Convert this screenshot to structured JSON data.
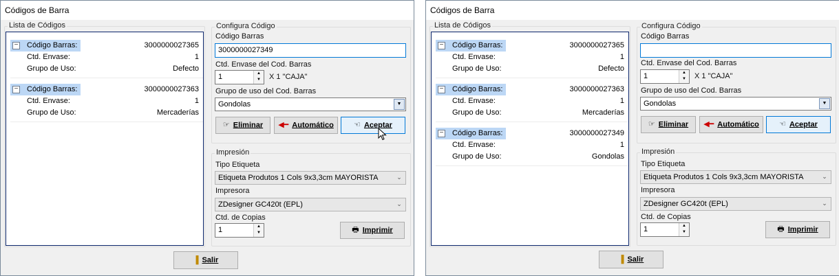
{
  "windows": [
    {
      "title": "Códigos de Barra",
      "codes_group_title": "Lista de Códigos",
      "codes": [
        {
          "barcode_label": "Código Barras:",
          "barcode": "3000000027365",
          "qty_label": "Ctd. Envase:",
          "qty": "1",
          "group_label": "Grupo de Uso:",
          "group": "Defecto"
        },
        {
          "barcode_label": "Código Barras:",
          "barcode": "3000000027363",
          "qty_label": "Ctd. Envase:",
          "qty": "1",
          "group_label": "Grupo de Uso:",
          "group": "Mercaderías"
        }
      ],
      "config": {
        "group_title": "Configura Código",
        "barcode_label": "Código Barras",
        "barcode_value": "3000000027349",
        "qty_label": "Ctd. Envase del Cod. Barras",
        "qty_value": "1",
        "qty_suffix": "X 1 \"CAJA\"",
        "use_group_label": "Grupo de uso del Cod. Barras",
        "use_group_value": "Gondolas",
        "delete_label": "Eliminar",
        "auto_label": "Automático",
        "accept_label": "Aceptar"
      },
      "print": {
        "group_title": "Impresión",
        "label_type_label": "Tipo Etiqueta",
        "label_type_value": "Etiqueta Produtos 1 Cols 9x3,3cm MAYORISTA",
        "printer_label": "Impresora",
        "printer_value": "ZDesigner GC420t (EPL)",
        "copies_label": "Ctd. de Copias",
        "copies_value": "1",
        "print_label": "Imprimir"
      },
      "exit_label": "Salir"
    },
    {
      "title": "Códigos de Barra",
      "codes_group_title": "Lista de Códigos",
      "codes": [
        {
          "barcode_label": "Código Barras:",
          "barcode": "3000000027365",
          "qty_label": "Ctd. Envase:",
          "qty": "1",
          "group_label": "Grupo de Uso:",
          "group": "Defecto"
        },
        {
          "barcode_label": "Código Barras:",
          "barcode": "3000000027363",
          "qty_label": "Ctd. Envase:",
          "qty": "1",
          "group_label": "Grupo de Uso:",
          "group": "Mercaderías"
        },
        {
          "barcode_label": "Código Barras:",
          "barcode": "3000000027349",
          "qty_label": "Ctd. Envase:",
          "qty": "1",
          "group_label": "Grupo de Uso:",
          "group": "Gondolas"
        }
      ],
      "config": {
        "group_title": "Configura Código",
        "barcode_label": "Código Barras",
        "barcode_value": "",
        "qty_label": "Ctd. Envase del Cod. Barras",
        "qty_value": "1",
        "qty_suffix": "X 1 \"CAJA\"",
        "use_group_label": "Grupo de uso del Cod. Barras",
        "use_group_value": "Gondolas",
        "delete_label": "Eliminar",
        "auto_label": "Automático",
        "accept_label": "Aceptar"
      },
      "print": {
        "group_title": "Impresión",
        "label_type_label": "Tipo Etiqueta",
        "label_type_value": "Etiqueta Produtos 1 Cols 9x3,3cm MAYORISTA",
        "printer_label": "Impresora",
        "printer_value": "ZDesigner GC420t (EPL)",
        "copies_label": "Ctd. de Copias",
        "copies_value": "1",
        "print_label": "Imprimir"
      },
      "exit_label": "Salir"
    }
  ],
  "icons": {
    "delete": "pointing-hand-icon",
    "auto": "red-arrow-left-icon",
    "accept": "pointing-hand-icon",
    "print": "printer-icon",
    "exit": "exit-door-icon",
    "collapse": "minus-box-icon",
    "cursor": "mouse-pointer-icon"
  },
  "colors": {
    "accent": "#0078d7",
    "selection": "#bcd7f5",
    "list_border": "#0a246a"
  }
}
